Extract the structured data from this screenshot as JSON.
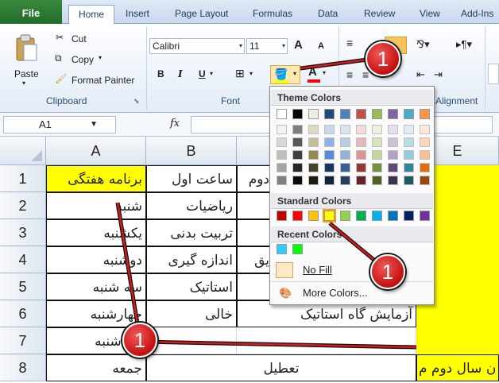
{
  "tabs": [
    {
      "label": "File"
    },
    {
      "label": "Home"
    },
    {
      "label": "Insert"
    },
    {
      "label": "Page Layout"
    },
    {
      "label": "Formulas"
    },
    {
      "label": "Data"
    },
    {
      "label": "Review"
    },
    {
      "label": "View"
    },
    {
      "label": "Add-Ins"
    }
  ],
  "clipboard": {
    "paste": "Paste",
    "cut": "Cut",
    "copy": "Copy",
    "format_painter": "Format Painter",
    "group_label": "Clipboard"
  },
  "font": {
    "name": "Calibri",
    "size": "11",
    "group_label": "Font",
    "bold": "B",
    "italic": "I",
    "underline": "U",
    "grow": "A",
    "shrink": "A",
    "font_color": "A"
  },
  "alignment": {
    "group_label": "Alignment"
  },
  "formula_bar": {
    "name_box": "A1",
    "fx": "fx",
    "value": ""
  },
  "columns": [
    "A",
    "B",
    "C",
    "D",
    "E"
  ],
  "rows": [
    "1",
    "2",
    "3",
    "4",
    "5",
    "6",
    "7",
    "8"
  ],
  "cells": {
    "A1": "برنامه هفتگی",
    "B1": "ساعت اول",
    "C1": "دوم",
    "A2": "شنبه",
    "B2": "ریاضیات",
    "A3": "یکشنبه",
    "B3": "تربیت بدنی",
    "A4": "دوشنبه",
    "B4": "اندازه گیری",
    "C4": "یق",
    "A5": "سه شنبه",
    "B5": "استاتیک",
    "A6": "چهارشنبه",
    "B6": "خالی",
    "C6": "آزمایش گاه استاتیک",
    "A7": "پنج شنبه",
    "A8": "جمعه",
    "B8": "تعطیل",
    "E8": "ن سال دوم م"
  },
  "palette": {
    "theme_title": "Theme Colors",
    "standard_title": "Standard Colors",
    "recent_title": "Recent Colors",
    "no_fill": "No Fill",
    "more_colors": "More Colors...",
    "theme_base": [
      "#ffffff",
      "#000000",
      "#eeece1",
      "#1f497d",
      "#4f81bd",
      "#c0504d",
      "#9bbb59",
      "#8064a2",
      "#4bacc6",
      "#f79646"
    ],
    "theme_shades": [
      [
        "#f2f2f2",
        "#7f7f7f",
        "#ddd9c3",
        "#c6d9f0",
        "#dbe5f1",
        "#f2dcdb",
        "#ebf1dd",
        "#e5e0ec",
        "#dbeef3",
        "#fdeada"
      ],
      [
        "#d8d8d8",
        "#595959",
        "#c4bd97",
        "#8db3e2",
        "#b8cce4",
        "#e5b9b7",
        "#d7e3bc",
        "#ccc1d9",
        "#b7dde8",
        "#fbd5b5"
      ],
      [
        "#bfbfbf",
        "#3f3f3f",
        "#938953",
        "#548dd4",
        "#95b3d7",
        "#d99694",
        "#c3d69b",
        "#b2a2c7",
        "#92cddc",
        "#fac08f"
      ],
      [
        "#a5a5a5",
        "#262626",
        "#494429",
        "#17365d",
        "#366092",
        "#953734",
        "#76923c",
        "#5f497a",
        "#31859b",
        "#e36c09"
      ],
      [
        "#7f7f7f",
        "#0c0c0c",
        "#1d1b10",
        "#0f243e",
        "#244061",
        "#632423",
        "#4f6128",
        "#3f3151",
        "#205867",
        "#974806"
      ]
    ],
    "standard": [
      "#c00000",
      "#ff0000",
      "#ffc000",
      "#ffff00",
      "#92d050",
      "#00b050",
      "#00b0f0",
      "#0070c0",
      "#002060",
      "#7030a0"
    ],
    "recent": [
      "#33ccff",
      "#00ff00"
    ],
    "selected_standard": "#ffff00"
  },
  "callouts": [
    {
      "label": "1"
    },
    {
      "label": "1"
    },
    {
      "label": "1"
    }
  ],
  "colors": {
    "fill_accent": "#ffff00",
    "callout_red": "#d11a1a",
    "font_red": "#ff0000"
  }
}
